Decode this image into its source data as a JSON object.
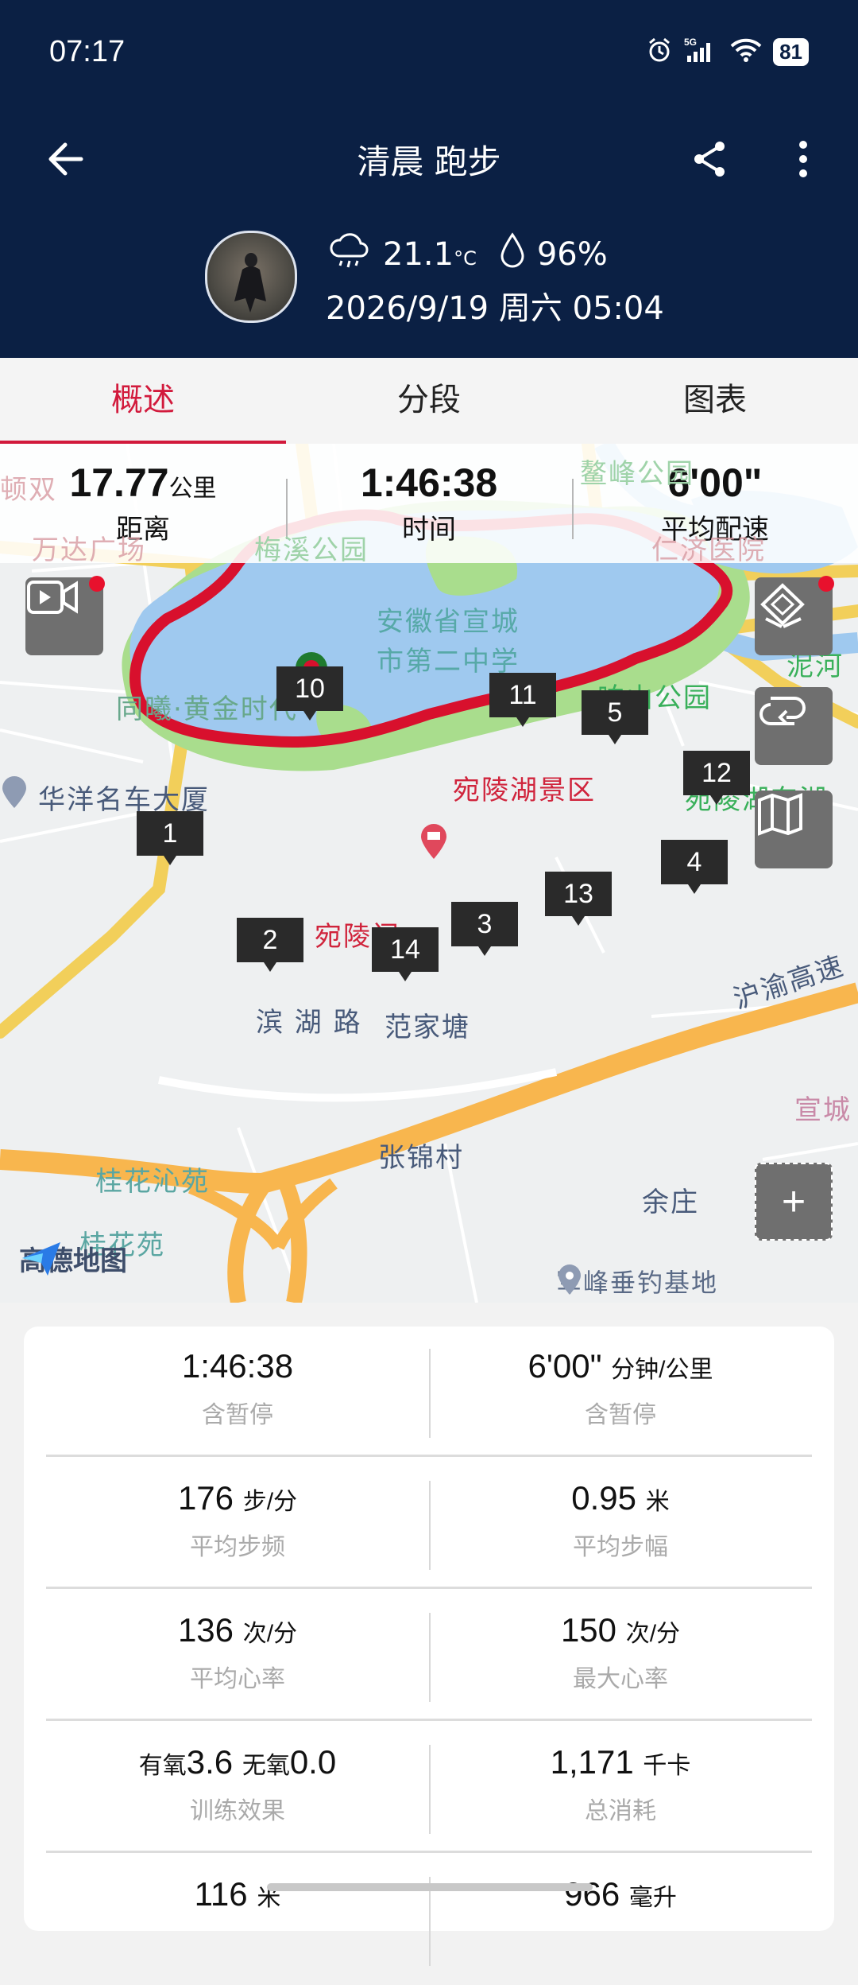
{
  "status_bar": {
    "time": "07:17",
    "battery": "81",
    "signal": "5G"
  },
  "header": {
    "title": "清晨 跑步",
    "temperature": "21.1",
    "temperature_unit": "°C",
    "humidity": "96%",
    "datetime": "2026/9/19 周六 05:04"
  },
  "tabs": [
    {
      "label": "概述",
      "active": true
    },
    {
      "label": "分段",
      "active": false
    },
    {
      "label": "图表",
      "active": false
    }
  ],
  "summary": {
    "distance_value": "17.77",
    "distance_unit": "公里",
    "distance_label": "距离",
    "time_value": "1:46:38",
    "time_label": "时间",
    "pace_value": "6'00\"",
    "pace_label": "平均配速"
  },
  "map": {
    "labels": {
      "meixi_park": "梅溪公园",
      "school": "安徽省宣城",
      "school2": "市第二中学",
      "xiangshan_park": "响山公园",
      "nihe": "泥河",
      "tongxi": "同曦·黄金时代",
      "huayang": "华洋名车大厦",
      "wanling_scenic": "宛陵湖景区",
      "wanling_east": "宛陵湖东湖",
      "wanling_pavilion": "宛陵阁",
      "binhu_road": "滨 湖 路",
      "fanjiatang": "范家塘",
      "hurong": "沪渝高速",
      "xuancheng": "宣城",
      "zhangjin": "张锦村",
      "yuzhuang": "余庄",
      "guihua_qin": "桂花沁苑",
      "guihua": "桂花苑",
      "wanda": "万达广场",
      "aofeng": "鳌峰公园",
      "renji": "仁济医院",
      "dunshuang": "顿双",
      "poi_bottom": "军峰垂钓基地",
      "logo": "高德地图"
    },
    "markers": [
      "1",
      "2",
      "3",
      "4",
      "5",
      "10",
      "11",
      "12",
      "13",
      "14"
    ],
    "route_color": "#d8102d",
    "buttons": {
      "zoom_in": "+"
    }
  },
  "stats": [
    {
      "left": {
        "value": "1:46:38",
        "unit": "",
        "label": "含暂停"
      },
      "right": {
        "value": "6'00\"",
        "unit": "分钟/公里",
        "label": "含暂停"
      }
    },
    {
      "left": {
        "value": "176",
        "unit": "步/分",
        "label": "平均步频"
      },
      "right": {
        "value": "0.95",
        "unit": "米",
        "label": "平均步幅"
      }
    },
    {
      "left": {
        "value": "136",
        "unit": "次/分",
        "label": "平均心率"
      },
      "right": {
        "value": "150",
        "unit": "次/分",
        "label": "最大心率"
      }
    },
    {
      "left": {
        "prefix1": "有氧",
        "value1": "3.6",
        "prefix2": "无氧",
        "value2": "0.0",
        "label": "训练效果"
      },
      "right": {
        "value": "1,171",
        "unit": "千卡",
        "label": "总消耗"
      }
    },
    {
      "left": {
        "value": "116",
        "unit": "米"
      },
      "right": {
        "value": "966",
        "unit": "毫升"
      }
    }
  ]
}
